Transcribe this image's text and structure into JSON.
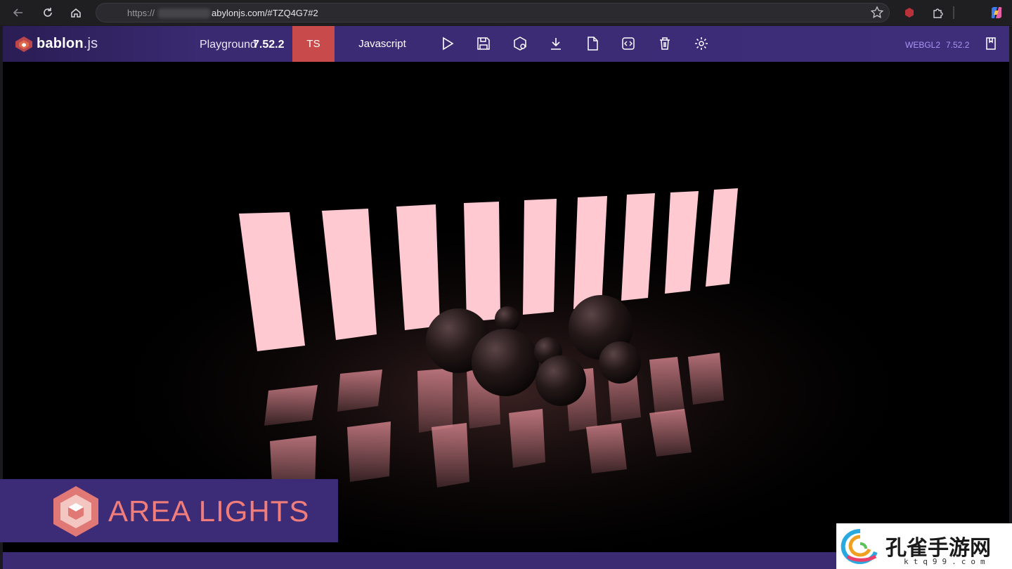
{
  "browser": {
    "url_scheme": "https://",
    "url_host": "abylonjs.com/#TZQ4G7#2"
  },
  "toolbar": {
    "logo_bold": "bab",
    "logo_mid": "lon",
    "logo_suffix": ".js",
    "playground_label": "Playground",
    "playground_version": "7.52.2",
    "ts_tab": "TS",
    "js_tab": "Javascript",
    "engine_label": "WEBGL2",
    "version_label": "7.52.2"
  },
  "banner": {
    "title": "AREA LIGHTS"
  },
  "watermark": {
    "title": "孔雀手游网",
    "sub": "ktq99.com"
  },
  "colors": {
    "toolbar": "#3e2e7a",
    "ts_tab": "#c94a4a",
    "accent_label": "#a796f5",
    "area_light": "#ffc9d2",
    "banner_text": "#f07d7a"
  }
}
